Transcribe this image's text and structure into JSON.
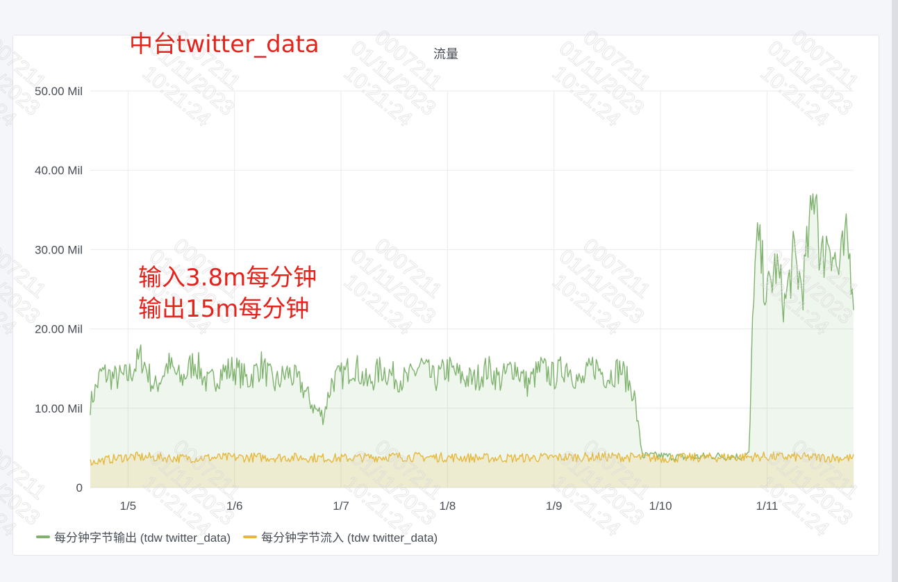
{
  "annotations": {
    "heading": "中台twitter_data",
    "line1": "输入3.8m每分钟",
    "line2": "输出15m每分钟"
  },
  "watermark": {
    "lines": [
      "0007211",
      "01/11/2023",
      "10:21:24"
    ]
  },
  "colors": {
    "output": "#7eb26d",
    "input": "#e5b83c",
    "annotation": "#e3231c"
  },
  "chart_data": {
    "type": "area",
    "title": "流量",
    "ylim": [
      0,
      50000000
    ],
    "y_ticks": [
      0,
      10000000,
      20000000,
      30000000,
      40000000,
      50000000
    ],
    "y_tick_labels": [
      "0",
      "10.00 Mil",
      "20.00 Mil",
      "30.00 Mil",
      "40.00 Mil",
      "50.00 Mil"
    ],
    "x_range": [
      "2023-01-04 15:30",
      "2023-01-11 19:30"
    ],
    "x_ticks": [
      "2023-01-05",
      "2023-01-06",
      "2023-01-07",
      "2023-01-08",
      "2023-01-09",
      "2023-01-10",
      "2023-01-11"
    ],
    "x_tick_labels": [
      "1/5",
      "1/6",
      "1/7",
      "1/8",
      "1/9",
      "1/10",
      "1/11"
    ],
    "grid": true,
    "legend_position": "bottom-left",
    "series": [
      {
        "name": "每分钟字节输出 (tdw twitter_data)",
        "color": "#7eb26d",
        "points": [
          [
            "2023-01-04 15:30",
            10500000
          ],
          [
            "2023-01-04 18:00",
            14500000
          ],
          [
            "2023-01-04 21:00",
            13800000
          ],
          [
            "2023-01-05 00:00",
            14000000
          ],
          [
            "2023-01-05 03:00",
            16500000
          ],
          [
            "2023-01-05 06:00",
            12500000
          ],
          [
            "2023-01-05 09:00",
            15500000
          ],
          [
            "2023-01-05 12:00",
            13500000
          ],
          [
            "2023-01-05 15:00",
            16000000
          ],
          [
            "2023-01-05 18:00",
            13000000
          ],
          [
            "2023-01-05 21:00",
            14500000
          ],
          [
            "2023-01-06 00:00",
            15000000
          ],
          [
            "2023-01-06 03:00",
            13500000
          ],
          [
            "2023-01-06 06:00",
            15500000
          ],
          [
            "2023-01-06 09:00",
            13000000
          ],
          [
            "2023-01-06 12:00",
            14500000
          ],
          [
            "2023-01-06 15:00",
            13000000
          ],
          [
            "2023-01-06 18:00",
            10000000
          ],
          [
            "2023-01-06 20:00",
            9000000
          ],
          [
            "2023-01-06 22:00",
            13500000
          ],
          [
            "2023-01-07 00:00",
            14000000
          ],
          [
            "2023-01-07 03:00",
            15500000
          ],
          [
            "2023-01-07 06:00",
            13000000
          ],
          [
            "2023-01-07 09:00",
            15000000
          ],
          [
            "2023-01-07 12:00",
            14000000
          ],
          [
            "2023-01-07 15:00",
            13500000
          ],
          [
            "2023-01-07 18:00",
            15500000
          ],
          [
            "2023-01-07 21:00",
            13500000
          ],
          [
            "2023-01-08 00:00",
            15000000
          ],
          [
            "2023-01-08 03:00",
            14000000
          ],
          [
            "2023-01-08 06:00",
            13500000
          ],
          [
            "2023-01-08 09:00",
            15000000
          ],
          [
            "2023-01-08 12:00",
            13500000
          ],
          [
            "2023-01-08 15:00",
            15500000
          ],
          [
            "2023-01-08 18:00",
            13000000
          ],
          [
            "2023-01-08 21:00",
            15000000
          ],
          [
            "2023-01-09 00:00",
            14000000
          ],
          [
            "2023-01-09 03:00",
            15500000
          ],
          [
            "2023-01-09 06:00",
            13000000
          ],
          [
            "2023-01-09 09:00",
            15500000
          ],
          [
            "2023-01-09 12:00",
            14000000
          ],
          [
            "2023-01-09 15:00",
            15000000
          ],
          [
            "2023-01-09 18:00",
            12000000
          ],
          [
            "2023-01-09 19:00",
            7500000
          ],
          [
            "2023-01-09 20:00",
            4000000
          ],
          [
            "2023-01-10 00:00",
            4000000
          ],
          [
            "2023-01-10 06:00",
            3800000
          ],
          [
            "2023-01-10 12:00",
            4000000
          ],
          [
            "2023-01-10 18:00",
            3900000
          ],
          [
            "2023-01-10 20:00",
            4200000
          ],
          [
            "2023-01-10 21:00",
            26000000
          ],
          [
            "2023-01-10 22:00",
            31000000
          ],
          [
            "2023-01-11 00:00",
            24000000
          ],
          [
            "2023-01-11 02:00",
            28000000
          ],
          [
            "2023-01-11 04:00",
            23000000
          ],
          [
            "2023-01-11 06:00",
            29000000
          ],
          [
            "2023-01-11 08:00",
            25000000
          ],
          [
            "2023-01-11 10:00",
            34000000
          ],
          [
            "2023-01-11 11:00",
            39500000
          ],
          [
            "2023-01-11 12:00",
            28000000
          ],
          [
            "2023-01-11 14:00",
            32000000
          ],
          [
            "2023-01-11 16:00",
            27000000
          ],
          [
            "2023-01-11 18:00",
            31000000
          ],
          [
            "2023-01-11 19:30",
            25500000
          ]
        ]
      },
      {
        "name": "每分钟字节流入 (tdw twitter_data)",
        "color": "#e5b83c",
        "points": [
          [
            "2023-01-04 15:30",
            3200000
          ],
          [
            "2023-01-05 00:00",
            3900000
          ],
          [
            "2023-01-05 12:00",
            3700000
          ],
          [
            "2023-01-06 00:00",
            3800000
          ],
          [
            "2023-01-06 12:00",
            3800000
          ],
          [
            "2023-01-07 00:00",
            3700000
          ],
          [
            "2023-01-07 12:00",
            3900000
          ],
          [
            "2023-01-08 00:00",
            3800000
          ],
          [
            "2023-01-08 12:00",
            3700000
          ],
          [
            "2023-01-09 00:00",
            3800000
          ],
          [
            "2023-01-09 12:00",
            3900000
          ],
          [
            "2023-01-10 00:00",
            3700000
          ],
          [
            "2023-01-10 12:00",
            3800000
          ],
          [
            "2023-01-11 00:00",
            3900000
          ],
          [
            "2023-01-11 12:00",
            3800000
          ],
          [
            "2023-01-11 19:30",
            3700000
          ]
        ]
      }
    ]
  }
}
